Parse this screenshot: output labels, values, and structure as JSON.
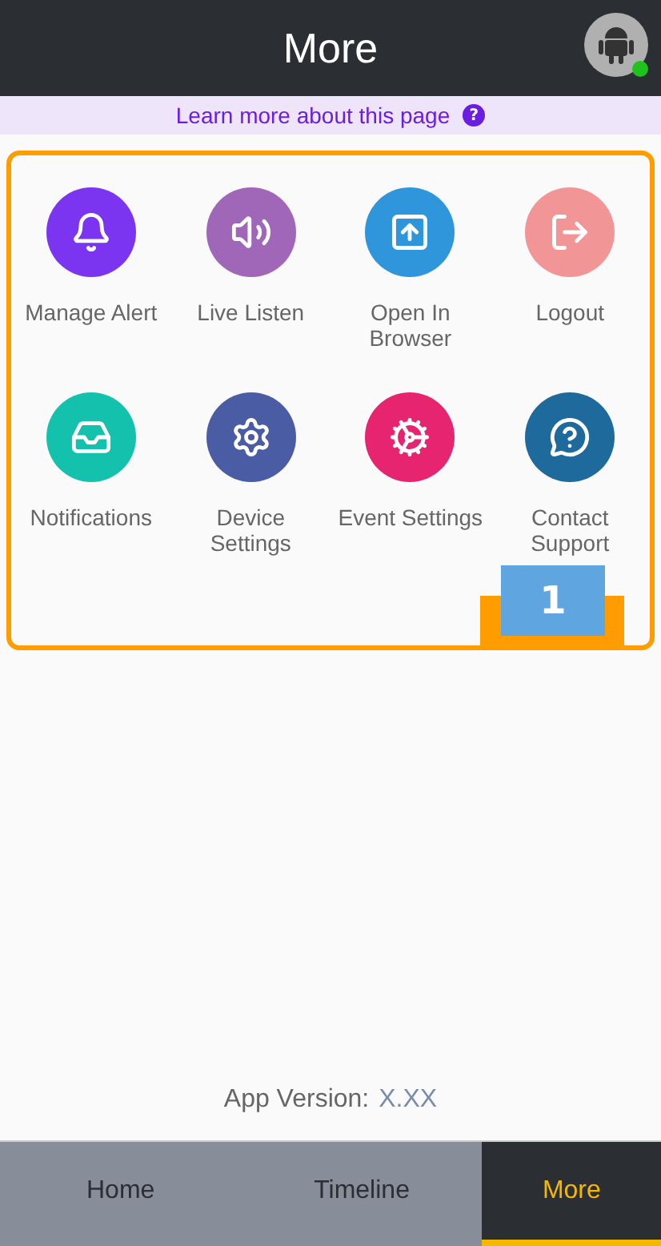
{
  "header": {
    "title": "More",
    "avatar": {
      "online": true
    }
  },
  "banner": {
    "text": "Learn more about this page",
    "help": "?"
  },
  "items": [
    {
      "label": "Manage Alert",
      "color": "#7b35f0"
    },
    {
      "label": "Live Listen",
      "color": "#a066b8"
    },
    {
      "label": "Open In Browser",
      "color": "#3096dc"
    },
    {
      "label": "Logout",
      "color": "#f29596"
    },
    {
      "label": "Notifications",
      "color": "#13c1ad"
    },
    {
      "label": "Device Settings",
      "color": "#4a5ca3"
    },
    {
      "label": "Event Settings",
      "color": "#e6246f"
    },
    {
      "label": "Contact Support",
      "color": "#1e6a9c"
    }
  ],
  "callout": {
    "label": "1"
  },
  "version": {
    "label": "App Version:",
    "value": "X.XX"
  },
  "tabs": [
    {
      "label": "Home",
      "selected": false
    },
    {
      "label": "Timeline",
      "selected": false
    },
    {
      "label": "More",
      "selected": true
    }
  ]
}
